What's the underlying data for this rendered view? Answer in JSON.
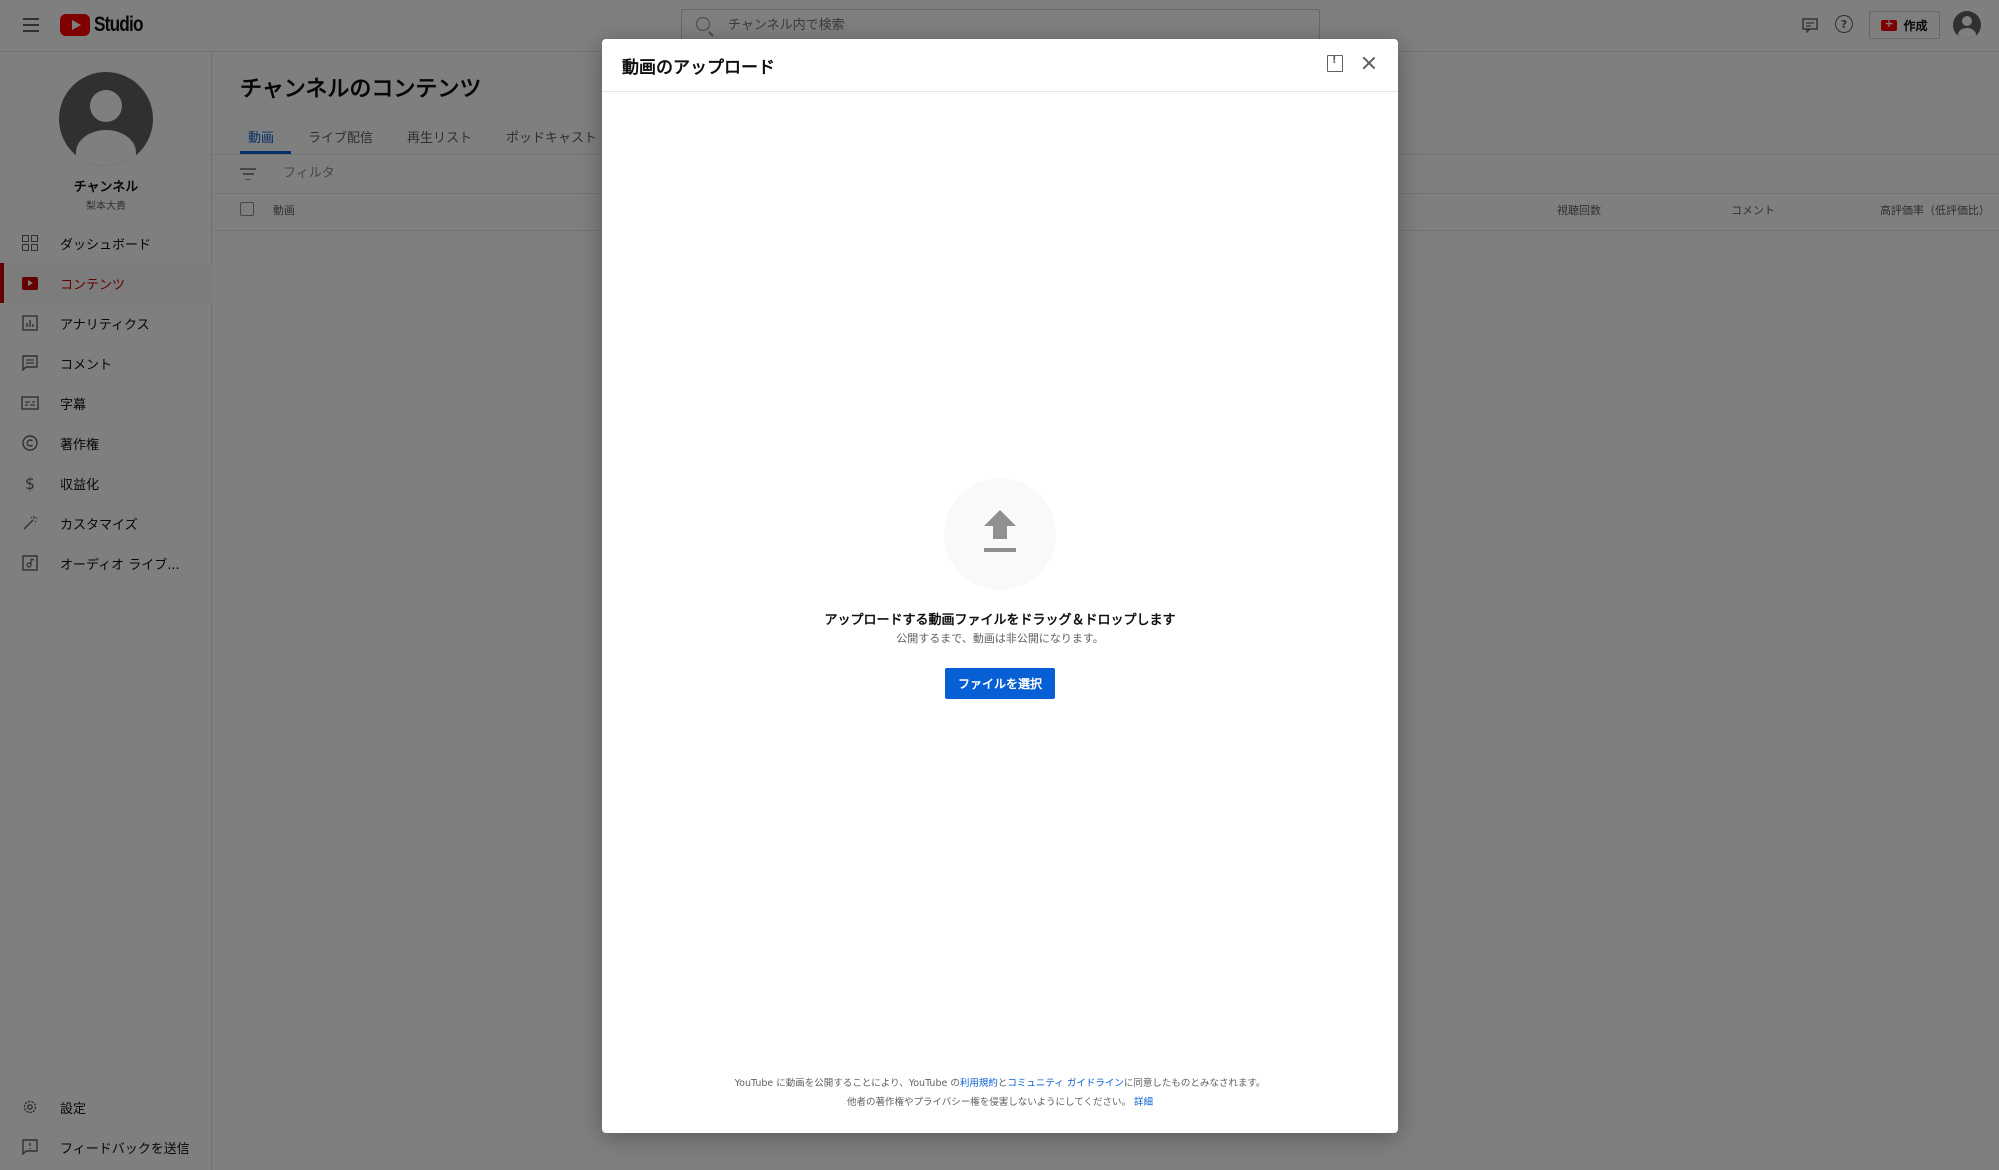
{
  "header": {
    "logo_text": "Studio",
    "search_placeholder": "チャンネル内で検索",
    "create_label": "作成"
  },
  "sidebar": {
    "channel_name": "チャンネル",
    "channel_sub": "梨本大貴",
    "items": [
      {
        "label": "ダッシュボード",
        "icon": "dashboard-icon"
      },
      {
        "label": "コンテンツ",
        "icon": "content-icon",
        "active": true
      },
      {
        "label": "アナリティクス",
        "icon": "analytics-icon"
      },
      {
        "label": "コメント",
        "icon": "comments-icon"
      },
      {
        "label": "字幕",
        "icon": "subtitles-icon"
      },
      {
        "label": "著作権",
        "icon": "copyright-icon"
      },
      {
        "label": "収益化",
        "icon": "dollar-icon"
      },
      {
        "label": "カスタマイズ",
        "icon": "wand-icon"
      },
      {
        "label": "オーディオ ライブ...",
        "icon": "audio-library-icon"
      }
    ],
    "bottom_items": [
      {
        "label": "設定",
        "icon": "gear-icon"
      },
      {
        "label": "フィードバックを送信",
        "icon": "feedback-icon"
      }
    ]
  },
  "main": {
    "title": "チャンネルのコンテンツ",
    "tabs": [
      "動画",
      "ライブ配信",
      "再生リスト",
      "ポッドキャスト"
    ],
    "filter_label": "フィルタ",
    "columns": [
      "動画",
      "視聴回数",
      "コメント",
      "高評価率（低評価比）"
    ]
  },
  "dialog": {
    "title": "動画のアップロード",
    "drop_title": "アップロードする動画ファイルをドラッグ＆ドロップします",
    "drop_sub": "公開するまで、動画は非公開になります。",
    "select_button": "ファイルを選択",
    "terms_line1_prefix": "YouTube に動画を公開することにより、YouTube の",
    "terms_link_tos": "利用規約",
    "terms_and": "と",
    "terms_link_guidelines": "コミュニティ ガイドライン",
    "terms_line1_suffix": "に同意したものとみなされます。",
    "terms_line2": "他者の著作権やプライバシー権を侵害しないようにしてください。",
    "terms_link_details": "詳細"
  },
  "colors": {
    "accent": "#065fd4",
    "brand_red": "#ff0000",
    "active_red": "#cc0000"
  }
}
